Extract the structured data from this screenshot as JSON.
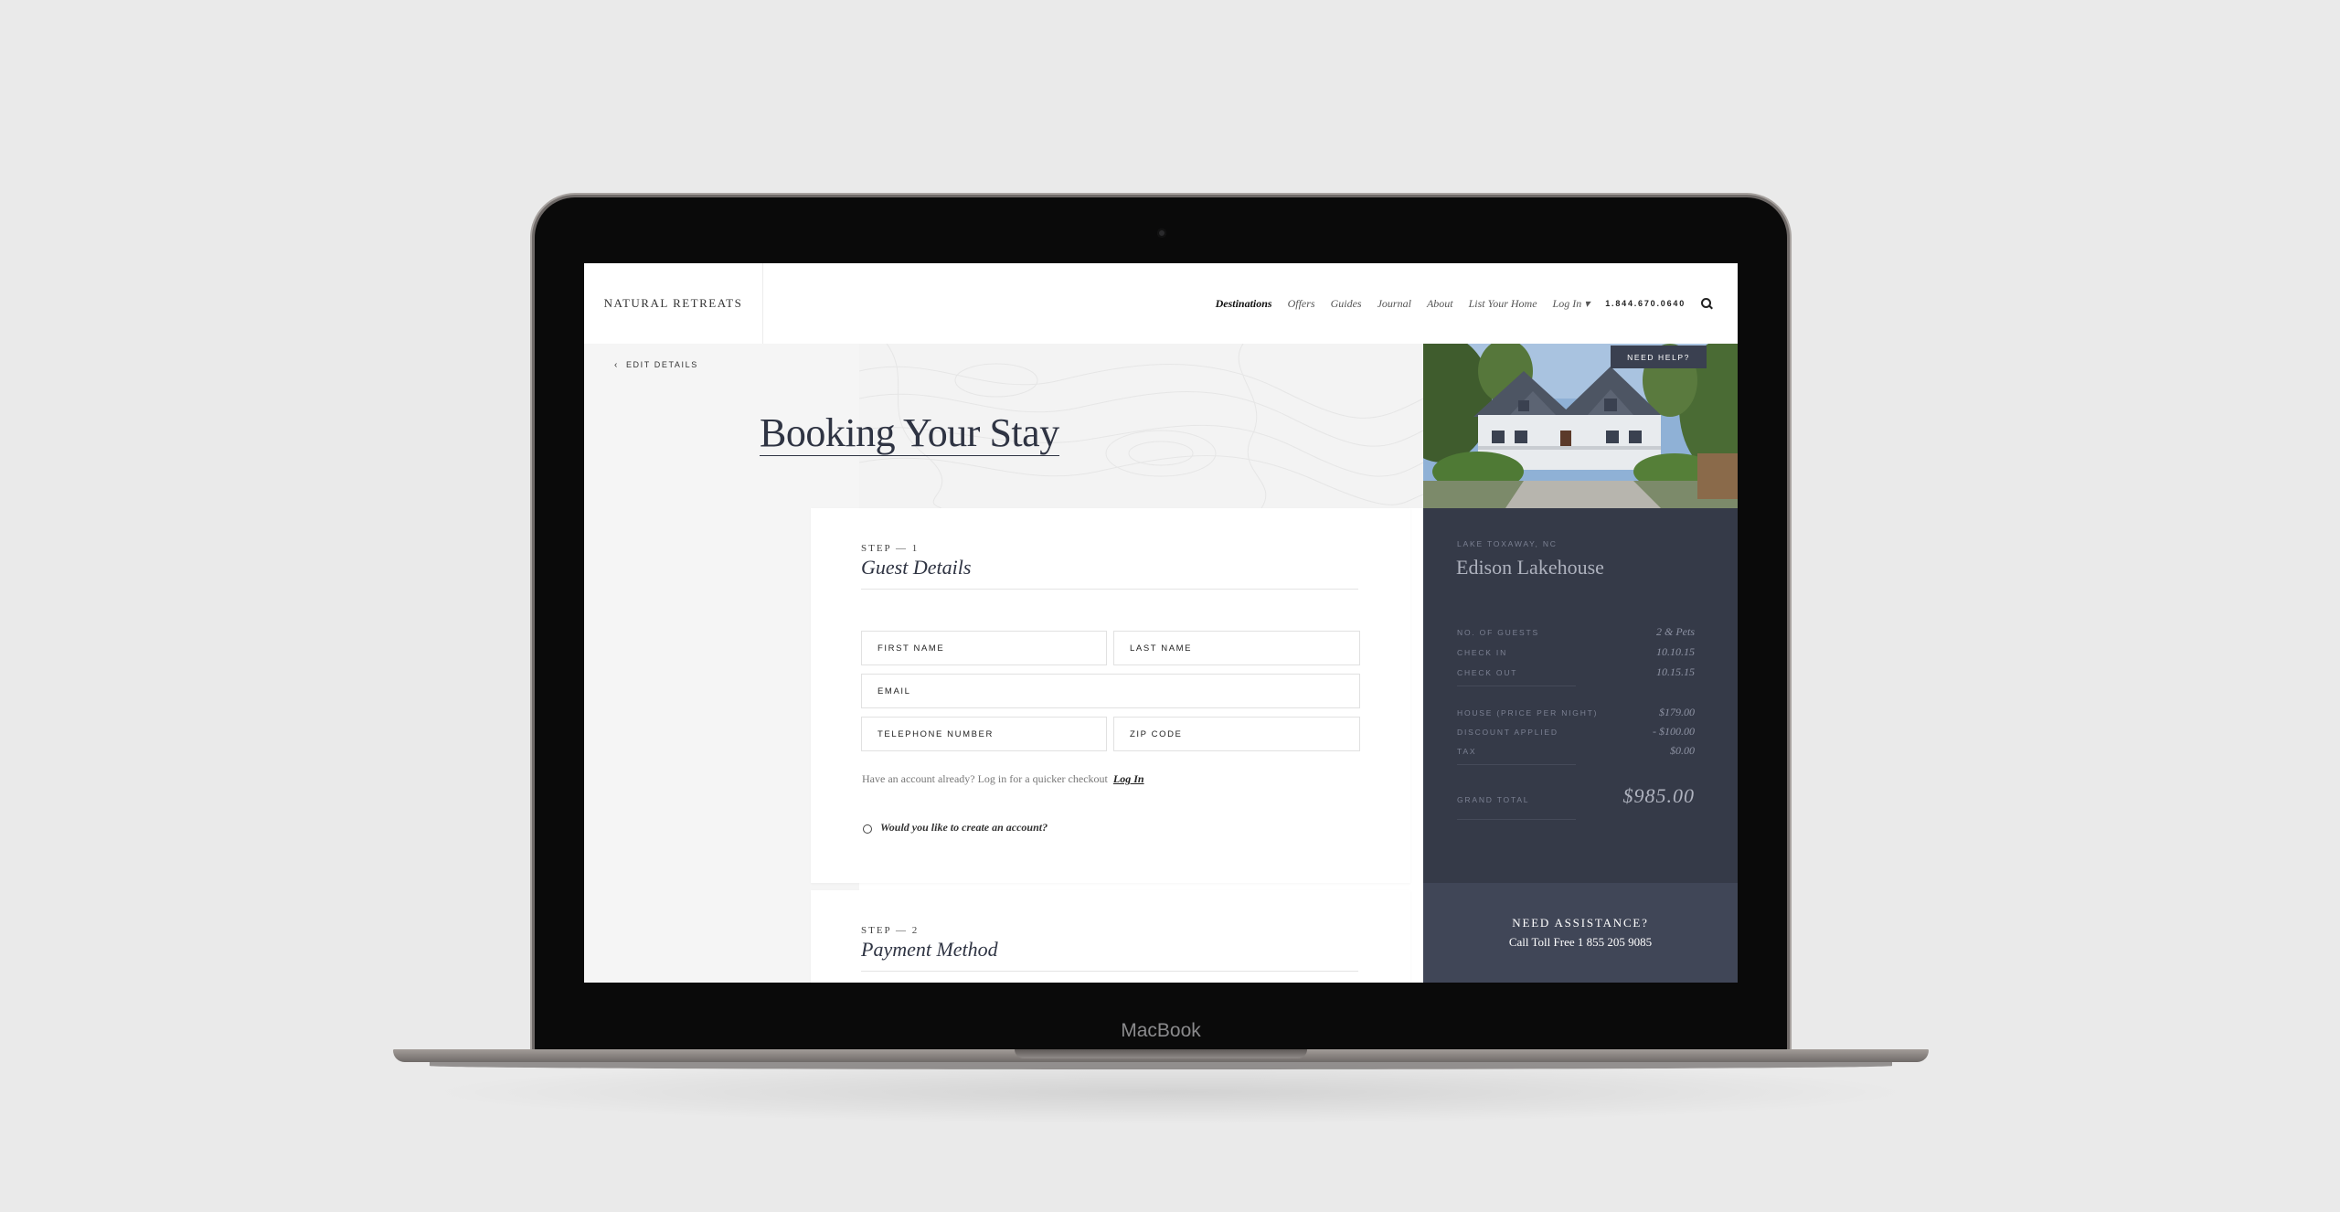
{
  "device": {
    "brand_label": "MacBook"
  },
  "nav": {
    "logo": "NATURAL RETREATS",
    "links": [
      {
        "label": "Destinations"
      },
      {
        "label": "Offers"
      },
      {
        "label": "Guides"
      },
      {
        "label": "Journal"
      },
      {
        "label": "About"
      },
      {
        "label": "List Your Home"
      },
      {
        "label": "Log In ▾"
      }
    ],
    "phone": "1.844.670.0640",
    "search_icon": "search-icon"
  },
  "page": {
    "back_label": "EDIT DETAILS",
    "title": "Booking Your Stay"
  },
  "step1": {
    "step_label": "STEP — 1",
    "title": "Guest Details",
    "fields": {
      "first_name": "FIRST NAME",
      "last_name": "LAST NAME",
      "email": "EMAIL",
      "telephone": "TELEPHONE NUMBER",
      "zip": "ZIP CODE"
    },
    "account_text": "Have an account already? Log in for a quicker checkout",
    "login_link": "Log In",
    "create_account": "Would you like to create an account?"
  },
  "step2": {
    "step_label": "STEP — 2",
    "title": "Payment Method"
  },
  "sidebar": {
    "need_help": "NEED HELP?",
    "location": "LAKE TOXAWAY, NC",
    "house_name": "Edison Lakehouse",
    "guests": {
      "label": "NO. OF GUESTS",
      "value": "2 & Pets"
    },
    "check_in": {
      "label": "CHECK IN",
      "value": "10.10.15"
    },
    "check_out": {
      "label": "CHECK OUT",
      "value": "10.15.15"
    },
    "price": {
      "label": "HOUSE (PRICE PER NIGHT)",
      "value": "$179.00"
    },
    "discount": {
      "label": "DISCOUNT APPLIED",
      "value": "- $100.00"
    },
    "tax": {
      "label": "TAX",
      "value": "$0.00"
    },
    "total": {
      "label": "GRAND TOTAL",
      "value": "$985.00"
    },
    "assist_title": "NEED ASSISTANCE?",
    "assist_phone": "Call Toll Free 1 855 205 9085"
  },
  "colors": {
    "navy": "#353a48",
    "navy_light": "#404657",
    "title": "#2f3443"
  }
}
